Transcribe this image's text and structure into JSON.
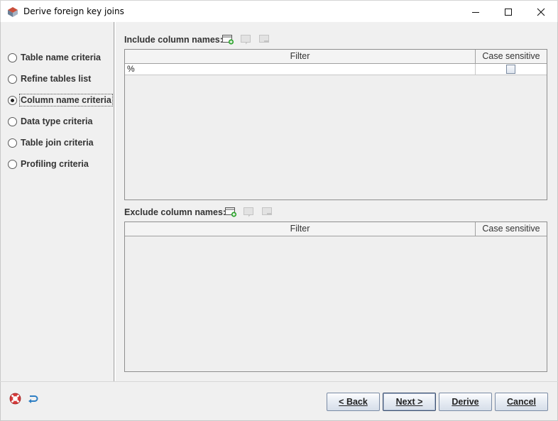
{
  "window": {
    "title": "Derive foreign key joins"
  },
  "steps": [
    {
      "label": "Table name criteria",
      "selected": false
    },
    {
      "label": "Refine tables list",
      "selected": false
    },
    {
      "label": "Column name criteria",
      "selected": true
    },
    {
      "label": "Data type criteria",
      "selected": false
    },
    {
      "label": "Table join criteria",
      "selected": false
    },
    {
      "label": "Profiling criteria",
      "selected": false
    }
  ],
  "include": {
    "label": "Include column names:",
    "columns": [
      "Filter",
      "Case sensitive"
    ],
    "rows": [
      {
        "filter": "%",
        "case_sensitive": false
      }
    ]
  },
  "exclude": {
    "label": "Exclude column names:",
    "columns": [
      "Filter",
      "Case sensitive"
    ],
    "rows": []
  },
  "buttons": {
    "back": "< Back",
    "next": "Next >",
    "derive": "Derive",
    "cancel": "Cancel"
  },
  "icons": {
    "add": "add-row-icon",
    "edit": "edit-row-icon",
    "remove": "remove-row-icon",
    "help": "help-lifebuoy-icon",
    "undo": "undo-icon"
  },
  "colors": {
    "background": "#f0f0f0",
    "accent_green": "#2fa52f",
    "button_border": "#7a8ba5"
  }
}
